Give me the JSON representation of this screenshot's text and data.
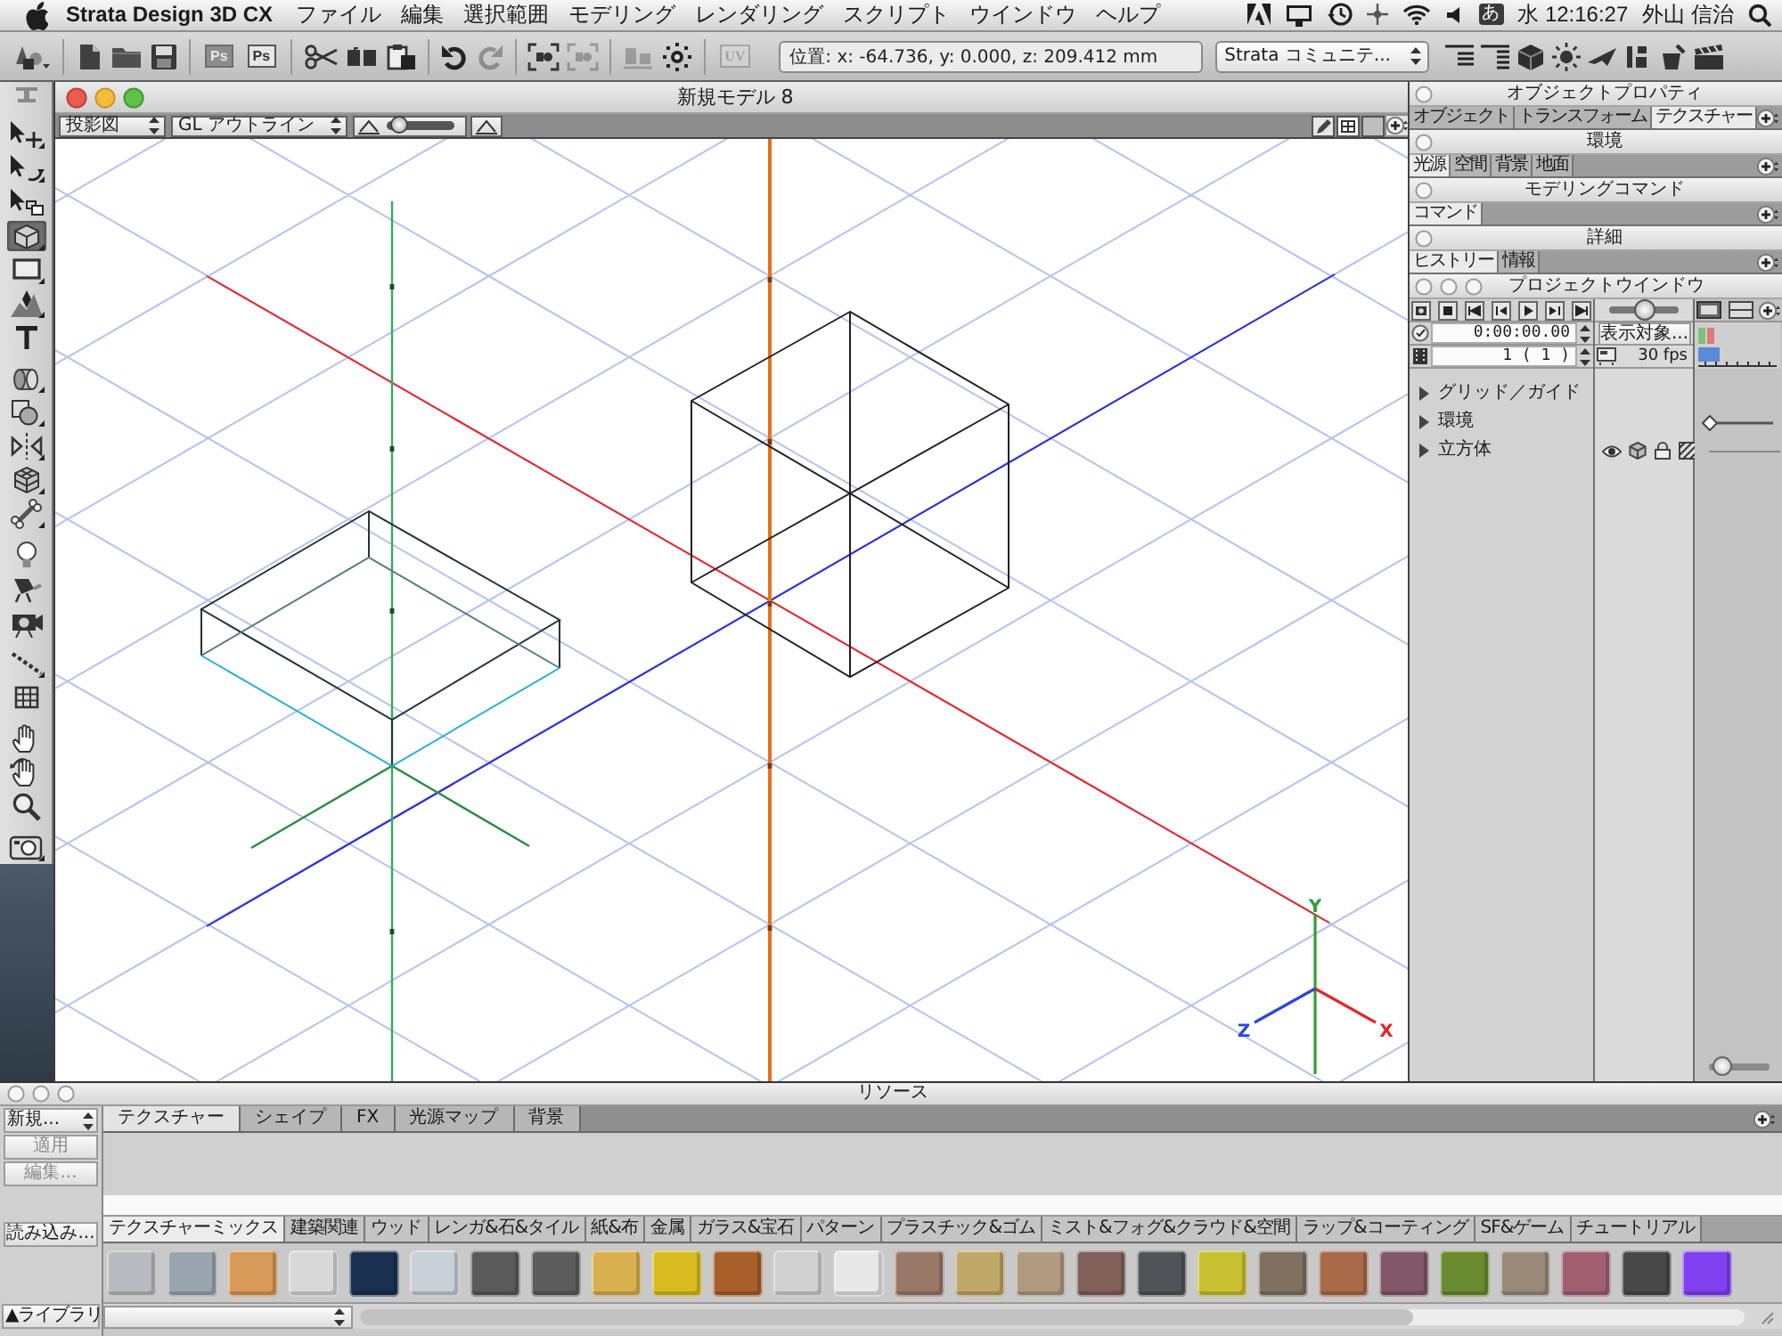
{
  "menu_bar": {
    "app_name": "Strata Design 3D CX",
    "menus": [
      "ファイル",
      "編集",
      "選択範囲",
      "モデリング",
      "レンダリング",
      "スクリプト",
      "ウインドウ",
      "ヘルプ"
    ],
    "input_method": "あ",
    "clock": "水 12:16:27",
    "user": "外山 信治"
  },
  "toolbar": {
    "button_groups": [
      [
        {
          "kind": "shapes",
          "disabled": false
        }
      ],
      [
        {
          "kind": "new",
          "disabled": false
        },
        {
          "kind": "open",
          "disabled": false
        },
        {
          "kind": "save",
          "disabled": false
        }
      ],
      [
        {
          "kind": "ps-solid",
          "label": "Ps",
          "disabled": false
        },
        {
          "kind": "ps-outline",
          "label": "Ps",
          "disabled": false
        }
      ],
      [
        {
          "kind": "cut",
          "disabled": false
        },
        {
          "kind": "copy",
          "disabled": false
        },
        {
          "kind": "paste",
          "disabled": false
        }
      ],
      [
        {
          "kind": "undo",
          "disabled": false
        },
        {
          "kind": "redo",
          "disabled": true
        }
      ],
      [
        {
          "kind": "frame",
          "disabled": false
        },
        {
          "kind": "frame",
          "disabled": true
        }
      ],
      [
        {
          "kind": "align",
          "disabled": true
        },
        {
          "kind": "center",
          "disabled": false
        }
      ],
      [
        {
          "kind": "uv",
          "label": "UV",
          "disabled": true
        }
      ]
    ],
    "position": "位置: x: -64.736, y: 0.000, z: 209.412 mm",
    "community": "Strata コミュニテ..."
  },
  "tool_groups": [
    [
      {
        "kind": "move",
        "selected": false
      },
      {
        "kind": "rotate",
        "selected": false
      },
      {
        "kind": "scale",
        "selected": false
      },
      {
        "kind": "cube",
        "selected": true
      },
      {
        "kind": "rectangle",
        "selected": false
      },
      {
        "kind": "pen",
        "selected": false
      },
      {
        "kind": "text",
        "selected": false
      }
    ],
    [
      {
        "kind": "extrude",
        "selected": false
      },
      {
        "kind": "shapes",
        "selected": false
      },
      {
        "kind": "mirror",
        "selected": false
      },
      {
        "kind": "cubes",
        "selected": false
      },
      {
        "kind": "bone",
        "selected": false
      }
    ],
    [
      {
        "kind": "bulb",
        "selected": false
      },
      {
        "kind": "spotlight",
        "selected": false
      },
      {
        "kind": "camera",
        "selected": false
      }
    ],
    [
      {
        "kind": "path",
        "selected": false
      },
      {
        "kind": "grid",
        "selected": false
      }
    ],
    [
      {
        "kind": "hand",
        "selected": false
      },
      {
        "kind": "hand-rotate",
        "selected": false
      },
      {
        "kind": "zoom",
        "selected": false
      }
    ],
    [
      {
        "kind": "render",
        "selected": false
      }
    ]
  ],
  "model_window": {
    "title": "新規モデル 8",
    "projection": "投影図",
    "render_mode": "GL アウトライン",
    "zoom_slider": {
      "level": 0.2
    },
    "axis_gizmo": [
      {
        "label": "Y",
        "color": "#2f9e3a"
      },
      {
        "label": "X",
        "color": "#e0282a"
      },
      {
        "label": "Z",
        "color": "#2a48d8"
      }
    ]
  },
  "panels": [
    {
      "title": "オブジェクトプロパティ",
      "tabs": [
        {
          "label": "オブジェクト",
          "selected": false
        },
        {
          "label": "トランスフォーム",
          "selected": false
        },
        {
          "label": "テクスチャー",
          "selected": true
        }
      ]
    },
    {
      "title": "環境",
      "tabs": [
        {
          "label": "光源",
          "selected": true
        },
        {
          "label": "空間",
          "selected": false
        },
        {
          "label": "背景",
          "selected": false
        },
        {
          "label": "地面",
          "selected": false
        }
      ]
    },
    {
      "title": "モデリングコマンド",
      "tabs": [
        {
          "label": "コマンド",
          "selected": true
        }
      ]
    },
    {
      "title": "詳細",
      "tabs": [
        {
          "label": "ヒストリー",
          "selected": true
        },
        {
          "label": "情報",
          "selected": false
        }
      ]
    }
  ],
  "project_window": {
    "title": "プロジェクトウインドウ",
    "time": "0:00:00.00",
    "frame": "1 ( 1 )",
    "display_button": "表示対象...",
    "fps": "30 fps",
    "timeline_slider": {
      "level": 0.5
    },
    "timeline_zoom": {
      "level": 0.2
    },
    "items": [
      {
        "kind": "guides",
        "label": "グリッド／ガイド",
        "expanded": false
      },
      {
        "kind": "environment",
        "label": "環境",
        "expanded": false
      },
      {
        "kind": "object",
        "label": "立方体",
        "expanded": false
      }
    ]
  },
  "resources": {
    "title": "リソース",
    "side_buttons": [
      {
        "kind": "new",
        "label": "新規...",
        "disabled": false
      },
      {
        "kind": "apply",
        "label": "適用",
        "disabled": true
      },
      {
        "kind": "edit",
        "label": "編集...",
        "disabled": true
      },
      {
        "kind": "load",
        "label": "読み込み...",
        "disabled": false
      }
    ],
    "library_button": "▲ライブラリ",
    "tabs": [
      {
        "label": "テクスチャー",
        "selected": true
      },
      {
        "label": "シェイプ",
        "selected": false
      },
      {
        "label": "FX",
        "selected": false
      },
      {
        "label": "光源マップ",
        "selected": false
      },
      {
        "label": "背景",
        "selected": false
      }
    ],
    "category_tabs": [
      {
        "label": "テクスチャーミックス",
        "selected": true
      },
      {
        "label": "建築関連",
        "selected": false
      },
      {
        "label": "ウッド",
        "selected": false
      },
      {
        "label": "レンガ&石&タイル",
        "selected": false
      },
      {
        "label": "紙&布",
        "selected": false
      },
      {
        "label": "金属",
        "selected": false
      },
      {
        "label": "ガラス&宝石",
        "selected": false
      },
      {
        "label": "パターン",
        "selected": false
      },
      {
        "label": "プラスチック&ゴム",
        "selected": false
      },
      {
        "label": "ミスト&フォグ&クラウド&空間",
        "selected": false
      },
      {
        "label": "ラップ&コーティング",
        "selected": false
      },
      {
        "label": "SF&ゲーム",
        "selected": false
      },
      {
        "label": "チュートリアル",
        "selected": false
      }
    ],
    "swatches": [
      {
        "color": "#b8bcc0"
      },
      {
        "color": "#9aa4b0"
      },
      {
        "color": "#d89a58"
      },
      {
        "color": "#d8d8d8"
      },
      {
        "color": "#1a3050"
      },
      {
        "color": "#c8d0d8"
      },
      {
        "color": "#5a5a5a"
      },
      {
        "color": "#5c5c5c"
      },
      {
        "color": "#d8b050"
      },
      {
        "color": "#d8bc20"
      },
      {
        "color": "#a8602a"
      },
      {
        "color": "#d0d0d0"
      },
      {
        "color": "#e8e8e8"
      },
      {
        "color": "#9a7868"
      },
      {
        "color": "#c0a868"
      },
      {
        "color": "#b09a80"
      },
      {
        "color": "#806058"
      },
      {
        "color": "#505458"
      },
      {
        "color": "#c8c030"
      },
      {
        "color": "#807060"
      },
      {
        "color": "#a86a48"
      },
      {
        "color": "#805868"
      },
      {
        "color": "#6a8a30"
      },
      {
        "color": "#9a8a7a"
      },
      {
        "color": "#a06070"
      },
      {
        "color": "#484848"
      },
      {
        "color": "#8040f0"
      }
    ]
  }
}
